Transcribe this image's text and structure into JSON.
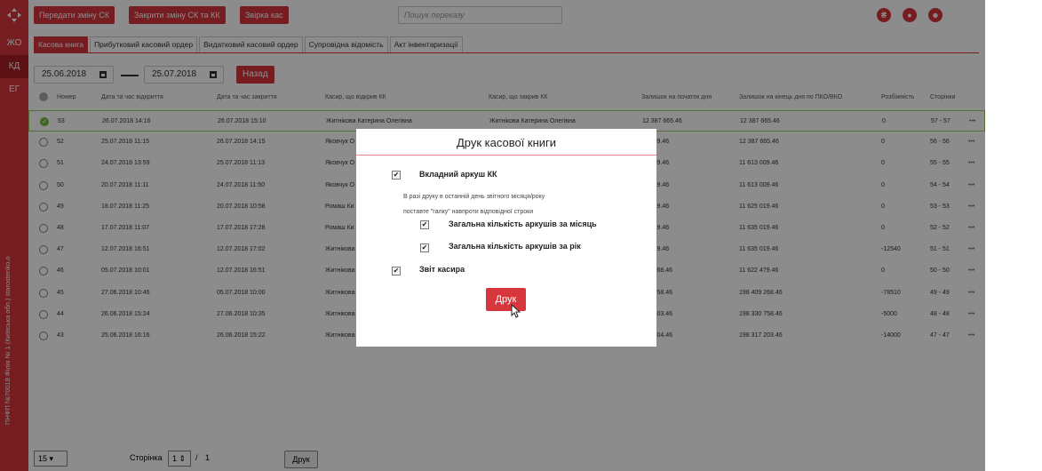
{
  "sidebar": {
    "items": [
      {
        "label": "ЖО"
      },
      {
        "label": "КД"
      },
      {
        "label": "ЕГ"
      }
    ],
    "vertical_text": "ПНФП №70018 Філія № 1 (Київська обл.) starostenko.o"
  },
  "header": {
    "buttons": {
      "transfer": "Передати зміну СК",
      "close": "Закрити зміну СК та КК",
      "count": "Звірка кас"
    },
    "search_placeholder": "Пошук переказу"
  },
  "tabs": [
    {
      "label": "Касова книга"
    },
    {
      "label": "Прибутковий касовий ордер"
    },
    {
      "label": "Видатковий касовий ордер"
    },
    {
      "label": "Супровідна відомість"
    },
    {
      "label": "Акт інвентаризації"
    }
  ],
  "filter": {
    "date_from": "25.06.2018",
    "date_to": "25.07.2018",
    "back_label": "Назад"
  },
  "table": {
    "columns": [
      "Номер",
      "Дата та час відкриття",
      "Дата та час закриття",
      "Касир, що відкрив КК",
      "Касир, що закрив КК",
      "Залишок на початок дня",
      "Залишок на кінець дня по ПКО/ВКО",
      "Розбіжність",
      "Сторінки"
    ],
    "rows": [
      {
        "num": "53",
        "open": "26.07.2018 14:16",
        "close": "26.07.2018 15:10",
        "opener": "Житнікова Катерина Олегівна",
        "closer": "Житнікова Катерина Олегівна",
        "start": "12 387 665.46",
        "end": "12 387 665.46",
        "diff": "0",
        "pages": "57 - 57",
        "selected": true
      },
      {
        "num": "52",
        "open": "25.07.2018 11:15",
        "close": "26.07.2018 14:15",
        "opener": "Яковчук О",
        "closer": "",
        "start": "13 009.46",
        "end": "12 387 665.46",
        "diff": "0",
        "pages": "56 - 56",
        "selected": false
      },
      {
        "num": "51",
        "open": "24.07.2018 13:59",
        "close": "25.07.2018 11:13",
        "opener": "Яковчук О",
        "closer": "",
        "start": "13 009.46",
        "end": "11 613 009.46",
        "diff": "0",
        "pages": "55 - 55",
        "selected": false
      },
      {
        "num": "50",
        "open": "20.07.2018 11:11",
        "close": "24.07.2018 11:50",
        "opener": "Яковчук О",
        "closer": "",
        "start": "25 019.46",
        "end": "11 613 009.46",
        "diff": "0",
        "pages": "54 - 54",
        "selected": false
      },
      {
        "num": "49",
        "open": "18.07.2018 11:25",
        "close": "20.07.2018 10:58",
        "opener": "Ромаш Ки",
        "closer": "",
        "start": "35 019.46",
        "end": "11 625 019.46",
        "diff": "0",
        "pages": "53 - 53",
        "selected": false
      },
      {
        "num": "48",
        "open": "17.07.2018 11:07",
        "close": "17.07.2018 17:28",
        "opener": "Ромаш Ки",
        "closer": "",
        "start": "35 019.46",
        "end": "11 635 019.46",
        "diff": "0",
        "pages": "52 - 52",
        "selected": false
      },
      {
        "num": "47",
        "open": "12.07.2018 16:51",
        "close": "12.07.2018 17:02",
        "opener": "Житнікова",
        "closer": "",
        "start": "22 479.46",
        "end": "11 635 019.46",
        "diff": "-12540",
        "pages": "51 - 51",
        "selected": false
      },
      {
        "num": "46",
        "open": "05.07.2018 10:01",
        "close": "12.07.2018 16:51",
        "opener": "Житнікова",
        "closer": "",
        "start": "409 268.46",
        "end": "11 622 479.46",
        "diff": "0",
        "pages": "50 - 50",
        "selected": false
      },
      {
        "num": "45",
        "open": "27.06.2018 10:46",
        "close": "05.07.2018 10:00",
        "opener": "Житнікова",
        "closer": "",
        "start": "330 758.46",
        "end": "198 409 268.46",
        "diff": "-78510",
        "pages": "49 - 49",
        "selected": false
      },
      {
        "num": "44",
        "open": "26.06.2018 15:24",
        "close": "27.06.2018 10:35",
        "opener": "Житнікова",
        "closer": "",
        "start": "317 203.46",
        "end": "198 330 758.46",
        "diff": "-5000",
        "pages": "48 - 48",
        "selected": false
      },
      {
        "num": "43",
        "open": "25.06.2018 16:16",
        "close": "26.06.2018 15:22",
        "opener": "Житнікова",
        "closer": "",
        "start": "321 804.46",
        "end": "198 317 203.46",
        "diff": "-14000",
        "pages": "47 - 47",
        "selected": false
      }
    ],
    "row_menu": "•••"
  },
  "footer": {
    "page_size": "15",
    "page_label": "Сторінка",
    "page_current": "1",
    "page_sep": "/",
    "page_total": "1",
    "print_label": "Друк"
  },
  "modal": {
    "title": "Друк касової книги",
    "opt_insert": "Вкладний аркуш КК",
    "note_line1": "В разі друку в останній день звітного місяця/року",
    "note_line2": "поставте \"галку\" навпроти відповідної строки",
    "opt_month": "Загальна кількість аркушів за місяць",
    "opt_year": "Загальна кількість аркушів за рік",
    "opt_report": "Звіт касира",
    "print_label": "Друк"
  },
  "colors": {
    "accent": "#d7363c",
    "accent_dark": "#a91e24",
    "select": "#6cbf3a"
  }
}
